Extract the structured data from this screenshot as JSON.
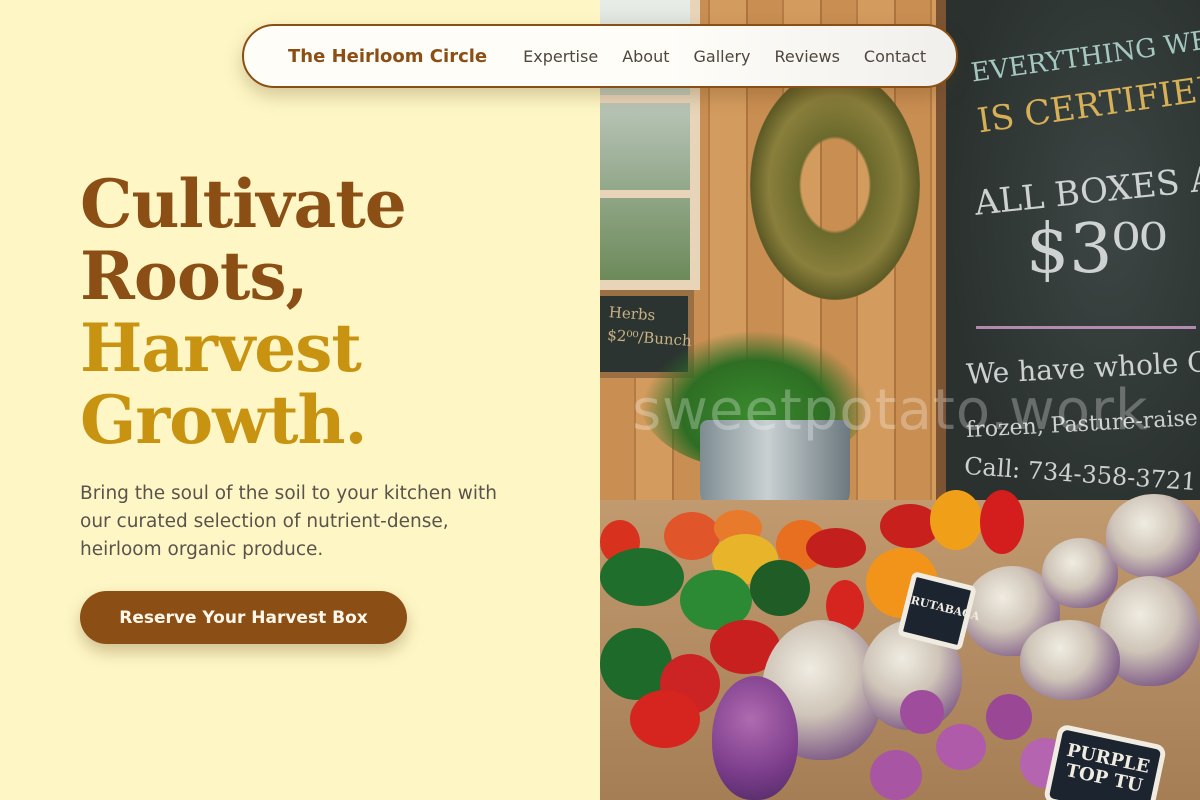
{
  "nav": {
    "brand": "The Heirloom Circle",
    "links": [
      "Expertise",
      "About",
      "Gallery",
      "Reviews",
      "Contact"
    ]
  },
  "hero": {
    "headline_line1": "Cultivate",
    "headline_line2": "Roots,",
    "headline_line3": "Harvest",
    "headline_line4": "Growth.",
    "subtitle": "Bring the soul of the soil to your kitchen with our curated selection of nutrient-dense, heirloom organic produce.",
    "cta_label": "Reserve Your Harvest Box"
  },
  "image": {
    "watermark": "sweetpotato.work",
    "chalkboard": {
      "line1": "EVERYTHING WE G",
      "line2": "IS CERTIFIED ORG",
      "line3": "ALL BOXES AR",
      "line4": "$3⁰⁰",
      "line5": "We have whole CHIC",
      "line6": "frozen, Pasture-raise",
      "line7": "Call: 734-358-3721"
    },
    "herb_sign": "Herbs $2⁰⁰/Bunch",
    "labels": [
      "RUTABAGA",
      "PURPLE TOP TU"
    ]
  },
  "colors": {
    "background": "#fef7c5",
    "brand_brown": "#8b4f16",
    "accent_gold": "#c99312",
    "body_text": "#5a534c"
  }
}
